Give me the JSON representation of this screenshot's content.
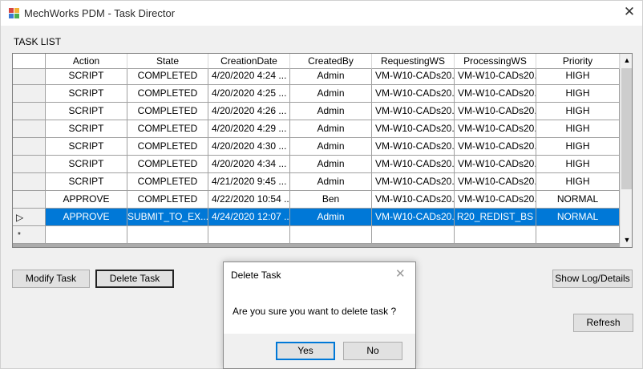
{
  "window": {
    "title": "MechWorks PDM - Task Director",
    "close_glyph": "✕"
  },
  "task_list": {
    "label": "TASK LIST",
    "columns": [
      "Action",
      "State",
      "CreationDate",
      "CreatedBy",
      "RequestingWS",
      "ProcessingWS",
      "Priority"
    ],
    "rows": [
      {
        "action": "SCRIPT",
        "state": "COMPLETED",
        "creation_date": "4/20/2020 4:24 ...",
        "created_by": "Admin",
        "requesting_ws": "VM-W10-CADs20...",
        "processing_ws": "VM-W10-CADs20...",
        "priority": "HIGH"
      },
      {
        "action": "SCRIPT",
        "state": "COMPLETED",
        "creation_date": "4/20/2020 4:25 ...",
        "created_by": "Admin",
        "requesting_ws": "VM-W10-CADs20...",
        "processing_ws": "VM-W10-CADs20...",
        "priority": "HIGH"
      },
      {
        "action": "SCRIPT",
        "state": "COMPLETED",
        "creation_date": "4/20/2020 4:26 ...",
        "created_by": "Admin",
        "requesting_ws": "VM-W10-CADs20...",
        "processing_ws": "VM-W10-CADs20...",
        "priority": "HIGH"
      },
      {
        "action": "SCRIPT",
        "state": "COMPLETED",
        "creation_date": "4/20/2020 4:29 ...",
        "created_by": "Admin",
        "requesting_ws": "VM-W10-CADs20...",
        "processing_ws": "VM-W10-CADs20...",
        "priority": "HIGH"
      },
      {
        "action": "SCRIPT",
        "state": "COMPLETED",
        "creation_date": "4/20/2020 4:30 ...",
        "created_by": "Admin",
        "requesting_ws": "VM-W10-CADs20...",
        "processing_ws": "VM-W10-CADs20...",
        "priority": "HIGH"
      },
      {
        "action": "SCRIPT",
        "state": "COMPLETED",
        "creation_date": "4/20/2020 4:34 ...",
        "created_by": "Admin",
        "requesting_ws": "VM-W10-CADs20...",
        "processing_ws": "VM-W10-CADs20...",
        "priority": "HIGH"
      },
      {
        "action": "SCRIPT",
        "state": "COMPLETED",
        "creation_date": "4/21/2020 9:45 ...",
        "created_by": "Admin",
        "requesting_ws": "VM-W10-CADs20...",
        "processing_ws": "VM-W10-CADs20...",
        "priority": "HIGH"
      },
      {
        "action": "APPROVE",
        "state": "COMPLETED",
        "creation_date": "4/22/2020 10:54 ...",
        "created_by": "Ben",
        "requesting_ws": "VM-W10-CADs20...",
        "processing_ws": "VM-W10-CADs20...",
        "priority": "NORMAL"
      },
      {
        "action": "APPROVE",
        "state": "SUBMIT_TO_EX...",
        "creation_date": "4/24/2020 12:07 ...",
        "created_by": "Admin",
        "requesting_ws": "VM-W10-CADs20...",
        "processing_ws": "R20_REDIST_BS",
        "priority": "NORMAL",
        "selected": true
      }
    ],
    "new_row_marker": "*",
    "current_row_marker": "▷",
    "selection_color": "#0078d7"
  },
  "buttons": {
    "modify": "Modify Task",
    "delete": "Delete Task",
    "show_log": "Show Log/Details",
    "refresh": "Refresh"
  },
  "dialog": {
    "title": "Delete Task",
    "message": "Are you sure you want to delete task ?",
    "yes": "Yes",
    "no": "No",
    "close_glyph": "✕"
  }
}
